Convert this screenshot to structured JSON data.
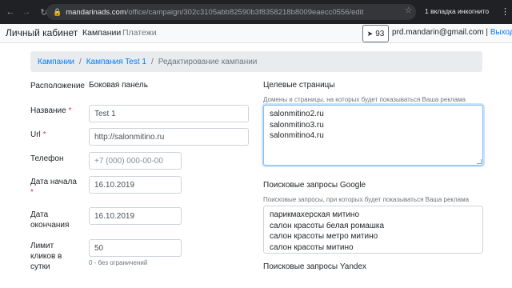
{
  "browser": {
    "url_host": "mandarinads.com",
    "url_path": "/office/campaign/302c3105abb82590b3f8358218b8009eaecc0556/edit",
    "incognito_label": "1 вкладка инкогнито"
  },
  "header": {
    "brand": "Личный кабинет",
    "nav": [
      "Кампании",
      "Платежи"
    ],
    "balance": "93",
    "user_email": "prd.mandarin@gmail.com",
    "separator": "|",
    "logout": "Выход"
  },
  "breadcrumb": {
    "items": [
      "Кампании",
      "Кампания Test 1"
    ],
    "active": "Редактирование кампании",
    "separator": "/"
  },
  "form": {
    "placement": {
      "label": "Расположение",
      "value": "Боковая панель"
    },
    "name": {
      "label": "Название",
      "value": "Test 1"
    },
    "url": {
      "label": "Url",
      "value": "http://salonmitino.ru"
    },
    "phone": {
      "label": "Телефон",
      "placeholder": "+7 (000) 000-00-00"
    },
    "start_date": {
      "label_line1": "Дата начала",
      "value": "16.10.2019"
    },
    "end_date": {
      "label_line1": "Дата",
      "label_line2": "окончания",
      "value": "16.10.2019"
    },
    "click_limit": {
      "label_line1": "Лимит",
      "label_line2": "кликов в",
      "label_line3": "сутки",
      "value": "50",
      "hint": "0 - без ограничений"
    },
    "required_mark": "*"
  },
  "targets": {
    "title": "Целевые страницы",
    "hint": "Домены и страницы, на которых будет показываться Ваша реклама",
    "lines": [
      "salonmitino2.ru",
      "salonmitino3.ru",
      "salonmitino4.ru"
    ]
  },
  "google": {
    "title": "Поисковые запросы Google",
    "hint": "Поисковые запросы, при которых будет показываться Ваша реклама",
    "lines": [
      "парикмахерская митино",
      "салон красоты белая ромашка",
      "салон красоты метро митино",
      "салон красоты митино"
    ]
  },
  "yandex": {
    "title": "Поисковые запросы Yandex"
  }
}
